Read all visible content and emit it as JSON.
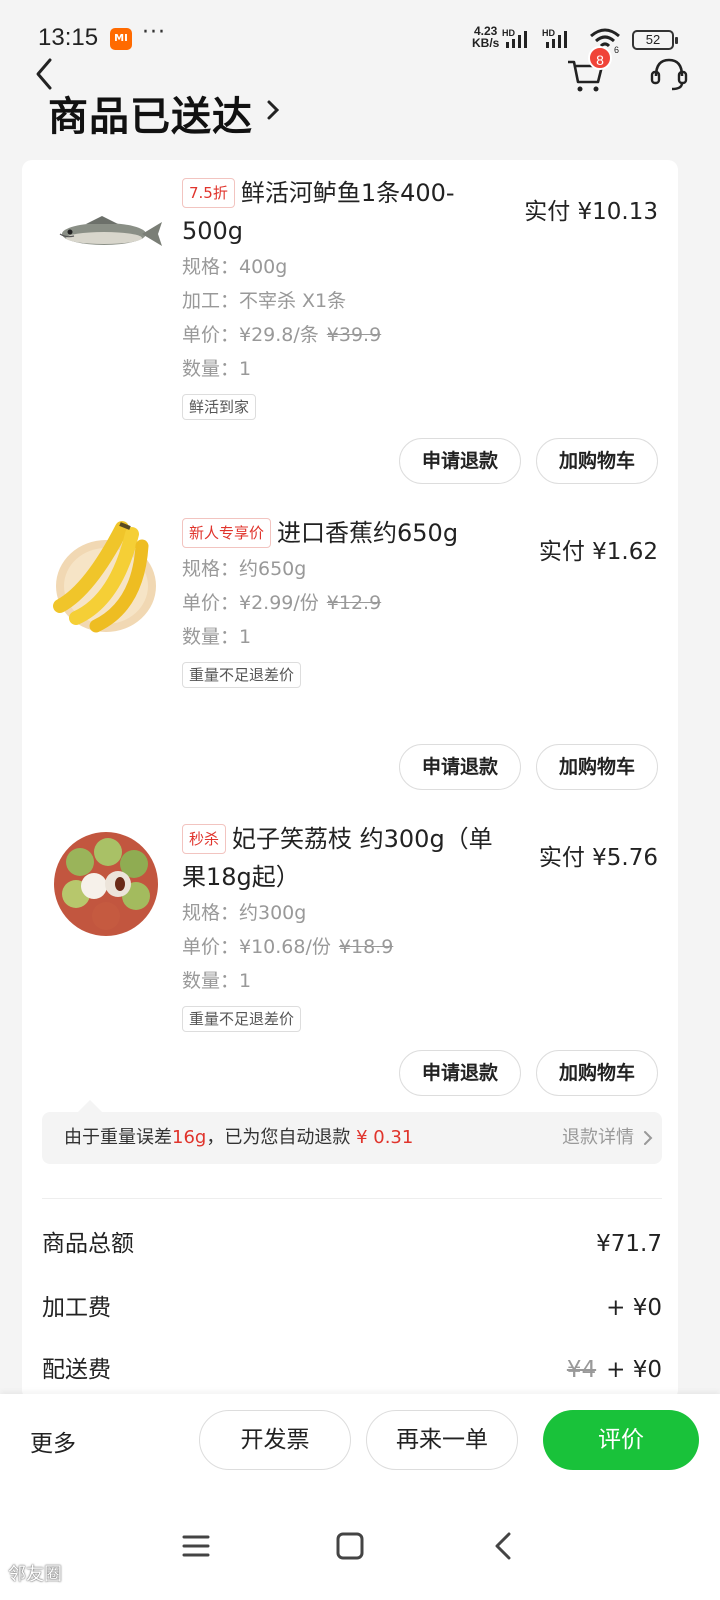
{
  "status_bar": {
    "time": "13:15",
    "mi_label": "MI",
    "dots": "···",
    "net_speed_value": "4.23",
    "net_speed_unit": "KB/s",
    "battery": "52",
    "hd_label": "HD",
    "wifi_label": "6"
  },
  "header": {
    "title": "商品已送达",
    "cart_count": "8",
    "icons": [
      "back-icon",
      "cart-icon",
      "customer-service-icon",
      "chevron-right-icon"
    ]
  },
  "items": [
    {
      "tag": "7.5折",
      "name": "鲜活河鲈鱼1条400-500g",
      "paid": "实付 ¥10.13",
      "specs": [
        "规格：400g",
        "加工：不宰杀 X1条"
      ],
      "unit_price": "单价：¥29.8/条",
      "original_price": "¥39.9",
      "quantity": "数量：1",
      "note": "鲜活到家",
      "refund_label": "申请退款",
      "add_cart_label": "加购物车"
    },
    {
      "tag": "新人专享价",
      "name": "进口香蕉约650g",
      "paid": "实付 ¥1.62",
      "specs": [
        "规格：约650g"
      ],
      "unit_price": "单价：¥2.99/份",
      "original_price": "¥12.9",
      "quantity": "数量：1",
      "note": "重量不足退差价",
      "refund_label": "申请退款",
      "add_cart_label": "加购物车"
    },
    {
      "tag": "秒杀",
      "name": "妃子笑荔枝 约300g（单果18g起）",
      "paid": "实付 ¥5.76",
      "specs": [
        "规格：约300g"
      ],
      "unit_price": "单价：¥10.68/份",
      "original_price": "¥18.9",
      "quantity": "数量：1",
      "note": "重量不足退差价",
      "refund_label": "申请退款",
      "add_cart_label": "加购物车"
    }
  ],
  "refund_notice": {
    "prefix": "由于重量误差",
    "weight": "16g",
    "middle": "，已为您自动退款",
    "amount": "¥ 0.31",
    "link": "退款详情"
  },
  "summary": {
    "goods_total_label": "商品总额",
    "goods_total_value": "¥71.7",
    "processing_fee_label": "加工费",
    "processing_fee_value": "+ ¥0",
    "delivery_fee_label": "配送费",
    "delivery_fee_original": "¥4",
    "delivery_fee_value": "+ ¥0"
  },
  "bottom_bar": {
    "more": "更多",
    "invoice": "开发票",
    "reorder": "再来一单",
    "review": "评价",
    "review_color": "#19c23a"
  },
  "watermark": "邻友圈"
}
